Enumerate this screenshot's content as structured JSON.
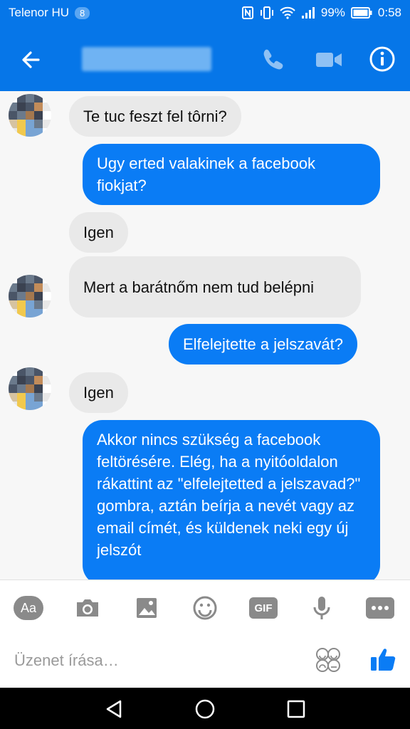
{
  "status_bar": {
    "carrier": "Telenor HU",
    "notification_count": "8",
    "battery": "99%",
    "time": "0:58"
  },
  "header": {
    "contact_name": ""
  },
  "messages": [
    {
      "from": "contact",
      "text": "Te tuc feszt fel tôrni?"
    },
    {
      "from": "me",
      "text": "Ugy erted valakinek a facebook fiokjat?"
    },
    {
      "from": "contact",
      "text": "Igen"
    },
    {
      "from": "contact",
      "text": "Mert a barátnőm nem tud belépni"
    },
    {
      "from": "me",
      "text": "Elfelejtette a jelszavát?"
    },
    {
      "from": "contact",
      "text": "Igen"
    },
    {
      "from": "me",
      "text": "Akkor nincs szükség a facebook feltörésére. Elég, ha a nyitóoldalon rákattint az \"elfelejtetted a jelszavad?\" gombra, aztán beírja a nevét vagy az email címét, és küldenek neki egy új jelszót"
    }
  ],
  "toolbar": {
    "text_button": "Aa",
    "gif_button": "GIF"
  },
  "composer": {
    "placeholder": "Üzenet írása…"
  },
  "colors": {
    "brand_blue": "#0676e8",
    "outgoing_bubble": "#0a7cf5",
    "incoming_bubble": "#e9e9e9"
  }
}
